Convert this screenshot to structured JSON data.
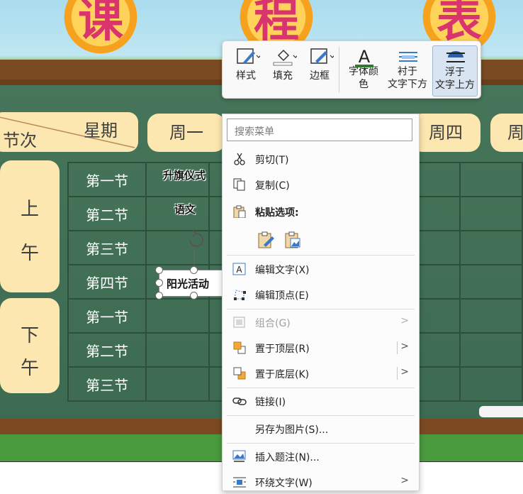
{
  "slide": {
    "title_chars": [
      "课",
      "程",
      "表"
    ],
    "header_cells": {
      "section": "节次",
      "weekday": "星期",
      "day1": "周一",
      "day4": "周四",
      "day5": "周"
    },
    "periods": {
      "morning": "上\n午",
      "afternoon": "下\n午"
    },
    "rows": [
      "第一节",
      "第二节",
      "第三节",
      "第四节",
      "第一节",
      "第二节",
      "第三节"
    ],
    "wordart": {
      "flag": "升旗仪式",
      "chinese": "语文",
      "sunshine": "阳光活动"
    }
  },
  "toolbar": {
    "style": "样式",
    "fill": "填充",
    "border": "边框",
    "font_color": "字体颜\n色",
    "behind_text": "衬于\n文字下方",
    "in_front_text": "浮于\n文字上方"
  },
  "menu": {
    "search_placeholder": "搜索菜单",
    "cut": "剪切(T)",
    "copy": "复制(C)",
    "paste_options": "粘贴选项:",
    "edit_text": "编辑文字(X)",
    "edit_points": "编辑顶点(E)",
    "group": "组合(G)",
    "bring_front": "置于顶层(R)",
    "send_back": "置于底层(K)",
    "link": "链接(I)",
    "save_as_picture": "另存为图片(S)...",
    "insert_caption": "插入题注(N)...",
    "wrap_text": "环绕文字(W)"
  },
  "colors": {
    "accent": "#d9e4f2",
    "board": "#3f6d55",
    "sun": "#f7a51c",
    "title": "#d9346d"
  }
}
